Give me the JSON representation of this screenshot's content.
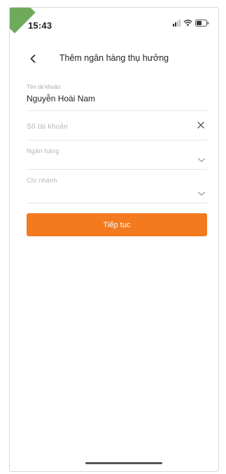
{
  "status_bar": {
    "time": "15:43",
    "icons": [
      "signal-icon",
      "wifi-icon",
      "battery-icon"
    ]
  },
  "header": {
    "back_icon": "chevron-left-icon",
    "title": "Thêm ngân hàng thụ hưởng"
  },
  "form": {
    "account_name": {
      "label": "Tên tài khoản",
      "value": "Nguyễn Hoài Nam"
    },
    "account_number": {
      "placeholder": "Số tài khoản",
      "value": "",
      "action_icon": "close-icon"
    },
    "bank": {
      "placeholder": "Ngân hàng",
      "selected": "",
      "action_icon": "chevron-down-icon"
    },
    "branch": {
      "placeholder": "Chi nhánh",
      "selected": "",
      "action_icon": "chevron-down-icon"
    }
  },
  "actions": {
    "continue_label": "Tiếp tục"
  },
  "colors": {
    "primary": "#f47a1f",
    "text": "#222222",
    "placeholder": "#b4b4b4",
    "divider": "#e6e6e6"
  }
}
